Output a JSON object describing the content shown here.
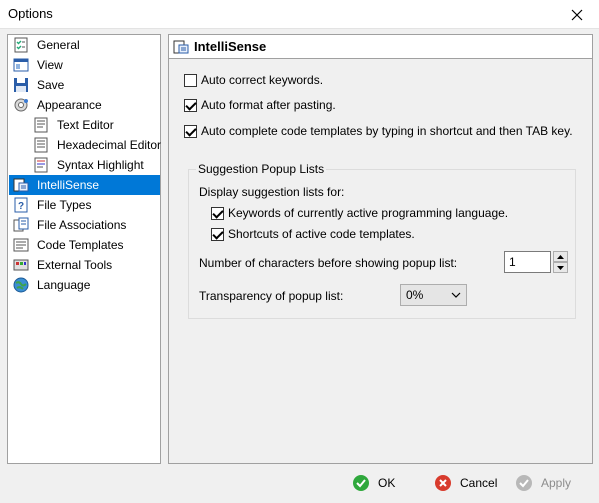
{
  "window": {
    "title": "Options"
  },
  "tree": {
    "items": [
      {
        "label": "General",
        "icon": "general-checklist-icon"
      },
      {
        "label": "View",
        "icon": "view-icon"
      },
      {
        "label": "Save",
        "icon": "save-floppy-icon"
      },
      {
        "label": "Appearance",
        "icon": "appearance-icon"
      },
      {
        "label": "Text Editor",
        "icon": "text-editor-icon"
      },
      {
        "label": "Hexadecimal Editor",
        "icon": "hex-editor-icon"
      },
      {
        "label": "Syntax Highlight",
        "icon": "syntax-highlight-icon"
      },
      {
        "label": "IntelliSense",
        "icon": "intellisense-icon"
      },
      {
        "label": "File Types",
        "icon": "file-types-icon"
      },
      {
        "label": "File Associations",
        "icon": "file-associations-icon"
      },
      {
        "label": "Code Templates",
        "icon": "code-templates-icon"
      },
      {
        "label": "External Tools",
        "icon": "external-tools-icon"
      },
      {
        "label": "Language",
        "icon": "globe-icon"
      }
    ],
    "selected": "IntelliSense"
  },
  "panel": {
    "title": "IntelliSense",
    "auto_correct": {
      "label": "Auto correct keywords.",
      "checked": false
    },
    "auto_format": {
      "label": "Auto format after pasting.",
      "checked": true
    },
    "auto_complete": {
      "label": "Auto complete code templates by typing in shortcut and then TAB key.",
      "checked": true
    },
    "group": {
      "legend": "Suggestion Popup Lists",
      "display_label": "Display suggestion lists for:",
      "keywords": {
        "label": "Keywords of currently active programming language.",
        "checked": true
      },
      "shortcuts": {
        "label": "Shortcuts of active code templates.",
        "checked": true
      },
      "chars_label": "Number of characters before showing popup list:",
      "chars_value": "1",
      "transparency_label": "Transparency of popup list:",
      "transparency_value": "0%"
    }
  },
  "footer": {
    "ok": "OK",
    "cancel": "Cancel",
    "apply": "Apply"
  },
  "colors": {
    "selection": "#0078d7",
    "ok_green": "#2fa83c",
    "cancel_red": "#d83b2d"
  }
}
